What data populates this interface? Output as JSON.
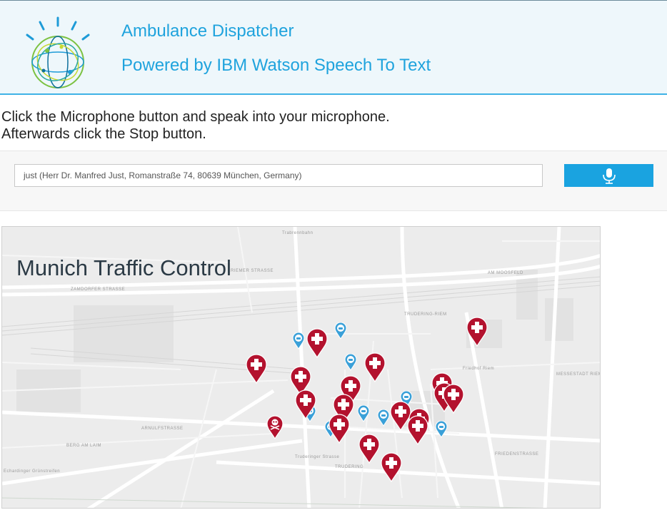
{
  "header": {
    "title": "Ambulance Dispatcher",
    "subtitle": "Powered by IBM Watson Speech To Text",
    "logo_icon": "ibm-watson-globe-icon"
  },
  "instructions": {
    "line1": "Click the Microphone button and speak into your microphone.",
    "line2": "Afterwards click the Stop button."
  },
  "speech": {
    "transcript": "just   (Herr Dr. Manfred Just, Romanstraße 74, 80639 München, Germany)",
    "button_icon": "microphone-icon",
    "button_color": "#1aa3e0"
  },
  "map": {
    "title": "Munich Traffic Control",
    "street_labels": [
      "Trabrennbahn",
      "RIEMER STRASSE",
      "ZAMDORFER STRASSE",
      "TRUDERING-RIEM",
      "AM MOOSFELD",
      "MESSESTADT RIEM",
      "Friedhof Riem",
      "ARNULFSTRASSE",
      "Truderinger Strasse",
      "TRUDERING",
      "Echardinger Grünstreifen",
      "BERG AM LAIM",
      "FRIEDENSTRASSE"
    ],
    "accent_emergency": "#b3122e",
    "accent_vehicle": "#3aa0d8"
  }
}
